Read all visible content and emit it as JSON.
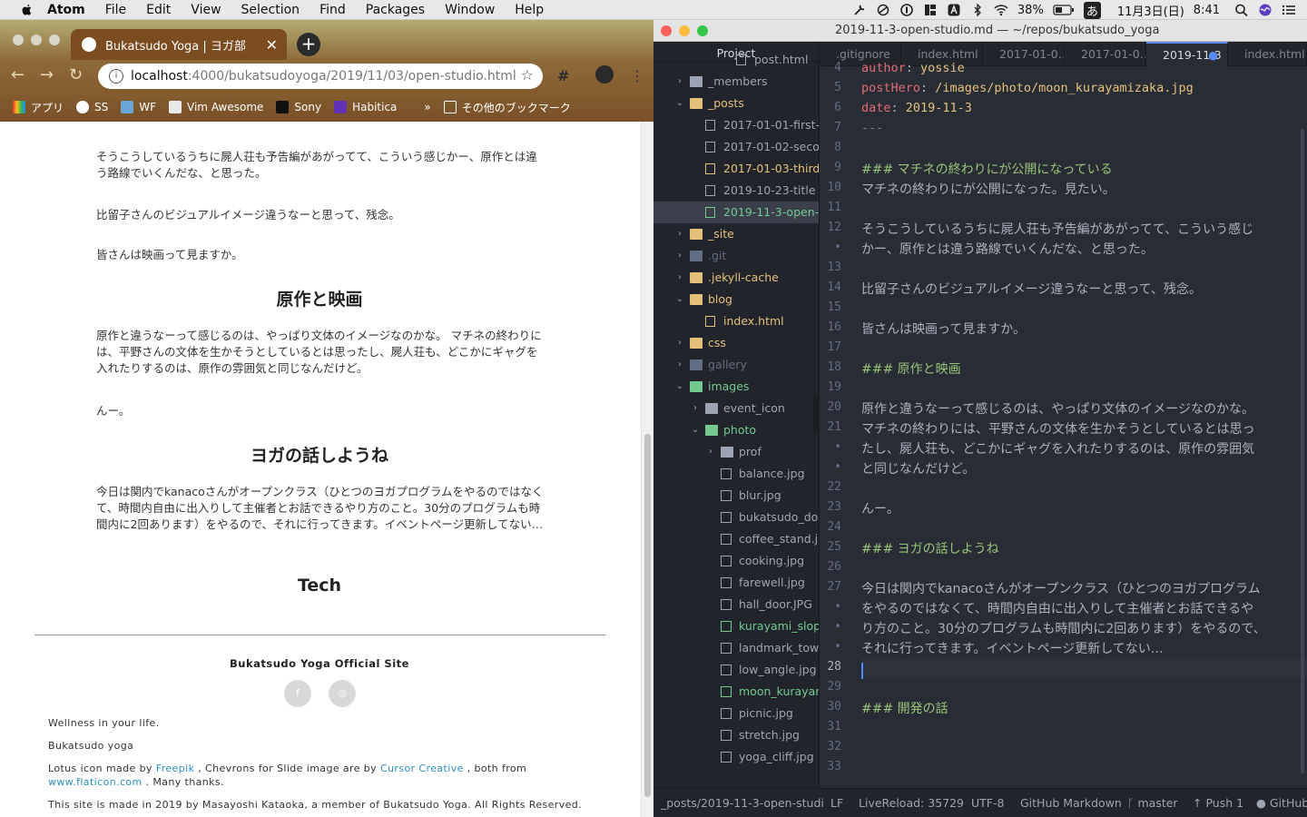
{
  "menubar": {
    "app": "Atom",
    "items": [
      "File",
      "Edit",
      "View",
      "Selection",
      "Find",
      "Packages",
      "Window",
      "Help"
    ],
    "battery": "38%",
    "ime": "あ",
    "date": "11月3日(日)",
    "time": "8:41"
  },
  "browser": {
    "tab_title": "Bukatsudo Yoga | ヨガ部",
    "url_host": "localhost",
    "url_path": ":4000/bukatsudoyoga/2019/11/03/open-studio.html",
    "bookmarks": [
      "アプリ",
      "SS",
      "WF",
      "Vim Awesome",
      "Sony",
      "Habitica"
    ],
    "other_bookmarks": "その他のブックマーク",
    "article": {
      "p1": "そうこうしているうちに屍人荘も予告編があがってて、こういう感じかー、原作とは違う路線でいくんだな、と思った。",
      "p2": "比留子さんのビジュアルイメージ違うなーと思って、残念。",
      "p3": "皆さんは映画って見ますか。",
      "h_film": "原作と映画",
      "p4": "原作と違うなーって感じるのは、やっぱり文体のイメージなのかな。 マチネの終わりには、平野さんの文体を生かそうとしているとは思ったし、屍人荘も、どこかにギャグを入れたりするのは、原作の雰囲気と同じなんだけど。",
      "p5": "んー。",
      "h_yoga": "ヨガの話しようね",
      "p6": "今日は関内でkanacoさんがオープンクラス（ひとつのヨガプログラムをやるのではなくて、時間内自由に出入りして主催者とお話できるやり方のこと。30分のプログラムも時間内に2回あります）をやるので、それに行ってきます。イベントページ更新してない…",
      "h_tech": "Tech"
    },
    "footer": {
      "title": "Bukatsudo Yoga Official Site",
      "social_1": "f",
      "social_2": "◎",
      "line1": "Wellness in your life.",
      "line2": "Bukatsudo yoga",
      "credit_a": "Lotus icon made by ",
      "credit_freepik": "Freepik",
      "credit_b": " , Chevrons for Slide image are by ",
      "credit_cursor": "Cursor Creative",
      "credit_c": " , both from",
      "credit_flaticon": "www.flaticon.com",
      "credit_d": " . Many thanks.",
      "copyright": "This site is made in 2019 by Masayoshi Kataoka, a member of Bukatsudo Yoga. All Rights Reserved."
    }
  },
  "atom": {
    "window_title": "2019-11-3-open-studio.md — ~/repos/bukatsudo_yoga",
    "tree_header": "Project",
    "tree": [
      {
        "label": "post.html",
        "kind": "file",
        "color": "#9da5b4"
      },
      {
        "label": "_members",
        "kind": "folder-closed",
        "color": "#9da5b4"
      },
      {
        "label": "_posts",
        "kind": "folder-open",
        "color": "#e5c07b"
      },
      {
        "label": "2017-01-01-first-",
        "kind": "file",
        "color": "#9da5b4"
      },
      {
        "label": "2017-01-02-seco",
        "kind": "file",
        "color": "#9da5b4"
      },
      {
        "label": "2017-01-03-third",
        "kind": "file",
        "color": "#e5c07b"
      },
      {
        "label": "2019-10-23-title",
        "kind": "file",
        "color": "#9da5b4"
      },
      {
        "label": "2019-11-3-open-",
        "kind": "file",
        "color": "#73c990"
      },
      {
        "label": "_site",
        "kind": "folder-closed",
        "color": "#e5c07b"
      },
      {
        "label": ".git",
        "kind": "folder-closed",
        "color": "#636d83"
      },
      {
        "label": ".jekyll-cache",
        "kind": "folder-closed",
        "color": "#e5c07b"
      },
      {
        "label": "blog",
        "kind": "folder-open",
        "color": "#e5c07b"
      },
      {
        "label": "index.html",
        "kind": "file",
        "color": "#e5c07b"
      },
      {
        "label": "css",
        "kind": "folder-closed",
        "color": "#e5c07b"
      },
      {
        "label": "gallery",
        "kind": "folder-closed",
        "color": "#636d83"
      },
      {
        "label": "images",
        "kind": "folder-open",
        "color": "#73c990"
      },
      {
        "label": "event_icon",
        "kind": "folder-closed",
        "color": "#9da5b4"
      },
      {
        "label": "photo",
        "kind": "folder-open",
        "color": "#73c990"
      },
      {
        "label": "prof",
        "kind": "folder-closed",
        "color": "#9da5b4"
      },
      {
        "label": "balance.jpg",
        "kind": "image",
        "color": "#9da5b4"
      },
      {
        "label": "blur.jpg",
        "kind": "image",
        "color": "#9da5b4"
      },
      {
        "label": "bukatsudo_do",
        "kind": "image",
        "color": "#9da5b4"
      },
      {
        "label": "coffee_stand.j",
        "kind": "image",
        "color": "#9da5b4"
      },
      {
        "label": "cooking.jpg",
        "kind": "image",
        "color": "#9da5b4"
      },
      {
        "label": "farewell.jpg",
        "kind": "image",
        "color": "#9da5b4"
      },
      {
        "label": "hall_door.JPG",
        "kind": "image",
        "color": "#9da5b4"
      },
      {
        "label": "kurayami_slop",
        "kind": "image",
        "color": "#73c990"
      },
      {
        "label": "landmark_tow",
        "kind": "image",
        "color": "#9da5b4"
      },
      {
        "label": "low_angle.jpg",
        "kind": "image",
        "color": "#9da5b4"
      },
      {
        "label": "moon_kurayar",
        "kind": "image",
        "color": "#73c990"
      },
      {
        "label": "picnic.jpg",
        "kind": "image",
        "color": "#9da5b4"
      },
      {
        "label": "stretch.jpg",
        "kind": "image",
        "color": "#9da5b4"
      },
      {
        "label": "yoga_cliff.jpg",
        "kind": "image",
        "color": "#9da5b4"
      }
    ],
    "tabs": [
      ".gitignore",
      "index.html",
      "2017-01-0…",
      "2017-01-0…",
      "2019-11-3",
      "index.html"
    ],
    "lines": [
      {
        "n": "4",
        "text": ""
      },
      {
        "n": "5",
        "text": ""
      },
      {
        "n": "6",
        "text": ""
      },
      {
        "n": "7",
        "text": ""
      },
      {
        "n": "8",
        "text": ""
      },
      {
        "n": "9",
        "text": ""
      },
      {
        "n": "10",
        "text": ""
      },
      {
        "n": "11",
        "text": ""
      },
      {
        "n": "12",
        "text": ""
      },
      {
        "n": "•",
        "text": ""
      },
      {
        "n": "13",
        "text": ""
      },
      {
        "n": "14",
        "text": ""
      },
      {
        "n": "15",
        "text": ""
      },
      {
        "n": "16",
        "text": ""
      },
      {
        "n": "17",
        "text": ""
      },
      {
        "n": "18",
        "text": ""
      },
      {
        "n": "19",
        "text": ""
      },
      {
        "n": "20",
        "text": ""
      },
      {
        "n": "21",
        "text": ""
      },
      {
        "n": "•",
        "text": ""
      },
      {
        "n": "•",
        "text": ""
      },
      {
        "n": "22",
        "text": ""
      },
      {
        "n": "23",
        "text": ""
      },
      {
        "n": "24",
        "text": ""
      },
      {
        "n": "25",
        "text": ""
      },
      {
        "n": "26",
        "text": ""
      },
      {
        "n": "27",
        "text": ""
      },
      {
        "n": "•",
        "text": ""
      },
      {
        "n": "•",
        "text": ""
      },
      {
        "n": "•",
        "text": ""
      },
      {
        "n": "28",
        "text": ""
      },
      {
        "n": "29",
        "text": ""
      },
      {
        "n": "30",
        "text": ""
      },
      {
        "n": "31",
        "text": ""
      },
      {
        "n": "32",
        "text": ""
      },
      {
        "n": "33",
        "text": ""
      }
    ],
    "code": {
      "author_key": "author",
      "author_val": "yossie",
      "posthero_key": "postHero",
      "posthero_val": "/images/photo/moon_kurayamizaka.jpg",
      "date_key": "date",
      "date_val": "2019-11-3",
      "fm_end": "---",
      "h_matinee": "### マチネの終わりにが公開になっている",
      "l10": "マチネの終わりにが公開になった。見たい。",
      "l12a": "そうこうしているうちに屍人荘も予告編があがってて、こういう感じ",
      "l12b": "かー、原作とは違う路線でいくんだな、と思った。",
      "l14": "比留子さんのビジュアルイメージ違うなーと思って、残念。",
      "l16": "皆さんは映画って見ますか。",
      "h_film": "### 原作と映画",
      "l20a": "原作と違うなーって感じるのは、やっぱり文体のイメージなのかな。",
      "l20b": "マチネの終わりには、平野さんの文体を生かそうとしているとは思っ",
      "l20c": "たし、屍人荘も、どこかにギャグを入れたりするのは、原作の雰囲気",
      "l20d": "と同じなんだけど。",
      "l23": "んー。",
      "h_yoga": "### ヨガの話しようね",
      "l27a": "今日は関内でkanacoさんがオープンクラス（ひとつのヨガプログラム",
      "l27b": "をやるのではなくて、時間内自由に出入りして主催者とお話できるや",
      "l27c": "り方のこと。30分のプログラムも時間内に2回あります）をやるので、",
      "l27d": "それに行ってきます。イベントページ更新してない…",
      "h_dev": "### 開発の話"
    },
    "status": {
      "path": "_posts/2019-11-3-open-studi",
      "eol": "LF",
      "livereload": "LiveReload: 35729",
      "encoding": "UTF-8",
      "grammar": "GitHub Markdown",
      "branch": "master",
      "push": "Push 1",
      "github": "GitHub"
    }
  }
}
